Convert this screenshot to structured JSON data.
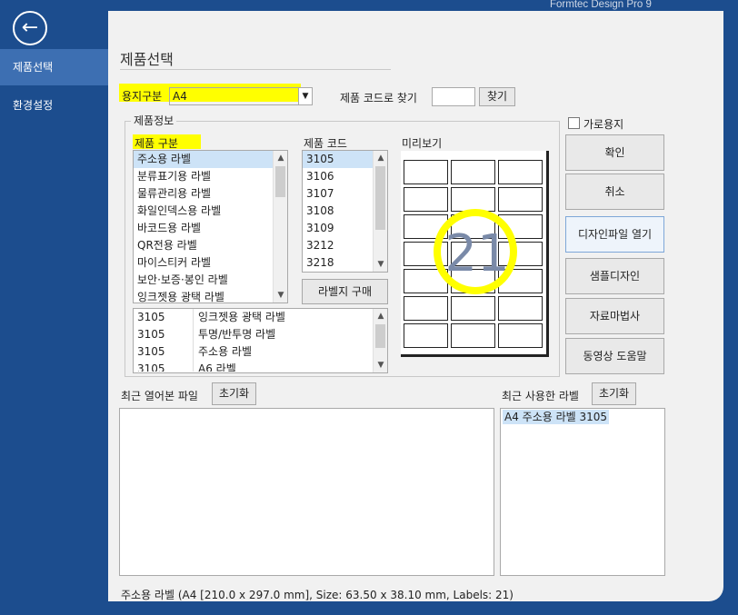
{
  "window": {
    "title": "Formtec Design Pro 9"
  },
  "sidebar": {
    "back_icon": "arrow-left-circle-icon",
    "items": [
      {
        "label": "제품선택",
        "selected": true
      },
      {
        "label": "환경설정",
        "selected": false
      }
    ]
  },
  "page": {
    "title": "제품선택"
  },
  "paper": {
    "label": "용지구분",
    "value": "A4"
  },
  "code_search": {
    "label": "제품 코드로 찾기",
    "value": "",
    "button": "찾기"
  },
  "landscape": {
    "label": "가로용지",
    "checked": false
  },
  "product_info": {
    "group_title": "제품정보",
    "category_header": "제품 구분",
    "categories": [
      "주소용 라벨",
      "분류표기용 라벨",
      "물류관리용 라벨",
      "화일인덱스용 라벨",
      "바코드용 라벨",
      "QR전용 라벨",
      "마이스티커 라벨",
      "보안·보증·봉인 라벨",
      "잉크젯용 광택 라벨"
    ],
    "selected_category": "주소용 라벨",
    "code_header": "제품 코드",
    "codes": [
      "3105",
      "3106",
      "3107",
      "3108",
      "3109",
      "3212",
      "3218"
    ],
    "selected_code": "3105",
    "buy_button": "라벨지 구매",
    "preview_header": "미리보기",
    "preview_count": "21",
    "matches": [
      {
        "code": "3105",
        "name": "잉크젯용 광택 라벨"
      },
      {
        "code": "3105",
        "name": "투명/반투명 라벨"
      },
      {
        "code": "3105",
        "name": "주소용 라벨"
      },
      {
        "code": "3105",
        "name": "A6 라벨"
      }
    ]
  },
  "actions": {
    "confirm": "확인",
    "cancel": "취소",
    "open_design": "디자인파일 열기",
    "sample_design": "샘플디자인",
    "data_wizard": "자료마법사",
    "video_help": "동영상 도움말"
  },
  "recent_files": {
    "label": "최근 열어본 파일",
    "reset": "초기화",
    "items": []
  },
  "recent_labels": {
    "label": "최근 사용한 라벨",
    "reset": "초기화",
    "items": [
      "A4 주소용 라벨 3105"
    ]
  },
  "status": {
    "text": "주소용 라벨 (A4 [210.0 x 297.0 mm], Size: 63.50 x 38.10 mm, Labels: 21)"
  },
  "colors": {
    "sidebar": "#1c4d8e",
    "sidebar_selected": "#3d6fb2",
    "highlight": "#ffff00",
    "panel": "#f1f1f1"
  }
}
